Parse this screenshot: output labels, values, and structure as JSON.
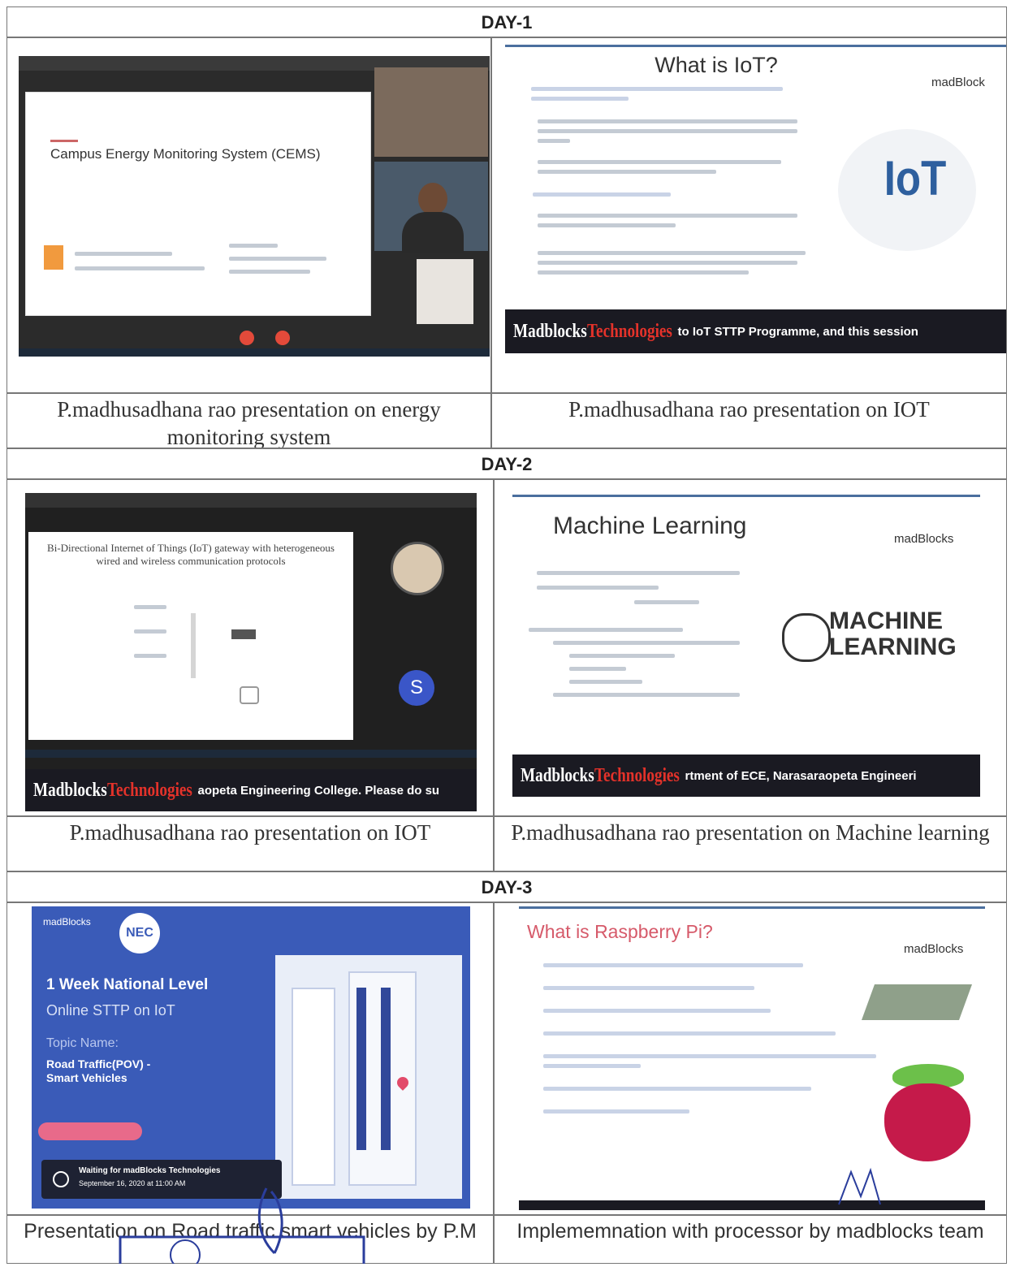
{
  "days": {
    "day1": "DAY-1",
    "day2": "DAY-2",
    "day3": "DAY-3"
  },
  "day1": {
    "left": {
      "slide_title": "Campus Energy Monitoring System (CEMS)",
      "caption": "P.madhusadhana rao presentation on energy monitoring system"
    },
    "right": {
      "slide_title": "What is IoT?",
      "logo": "madBlock",
      "big_word": "IoT",
      "banner_a": "Madblocks",
      "banner_b": "Technologies",
      "banner_ticker": "to IoT STTP Programme, and this session",
      "caption": "P.madhusadhana rao presentation on IOT"
    }
  },
  "day2": {
    "left": {
      "slide_title": "Bi-Directional Internet of Things (IoT) gateway with heterogeneous wired and wireless communication protocols",
      "participant_initial": "S",
      "banner_a": "Madblocks",
      "banner_b": "Technologies",
      "banner_ticker": "aopeta Engineering College. Please do su",
      "caption": "P.madhusadhana rao presentation on IOT"
    },
    "right": {
      "slide_title": "Machine Learning",
      "logo": "madBlocks",
      "ml_line1": "MACHINE",
      "ml_line2": "LEARNING",
      "banner_a": "Madblocks",
      "banner_b": "Technologies",
      "banner_ticker": "rtment of ECE, Narasaraopeta Engineeri",
      "caption": "P.madhusadhana rao presentation on Machine learning"
    }
  },
  "day3": {
    "left": {
      "logo": "madBlocks",
      "badge": "NEC",
      "heading": "1 Week National Level",
      "subheading": "Online STTP on IoT",
      "topic_label": "Topic Name:",
      "topic": "Road Traffic(POV) - Smart Vehicles",
      "waiting_line1": "Waiting for madBlocks Technologies",
      "waiting_line2": "September 16, 2020 at 11:00 AM",
      "caption": "Presentation on Road traffic smart vehicles by P.M"
    },
    "right": {
      "slide_title": "What is Raspberry Pi?",
      "logo": "madBlocks",
      "caption": "Implememnation with processor by madblocks team"
    }
  },
  "colors": {
    "banner": "#1a1a22",
    "brand_red": "#e3322a",
    "iot_blue": "#2e5f9e",
    "poster_blue": "#3a5bb8",
    "raspberry": "#c51a4a",
    "leaf": "#6cc04a",
    "stamp_blue": "#2a3d9c"
  }
}
